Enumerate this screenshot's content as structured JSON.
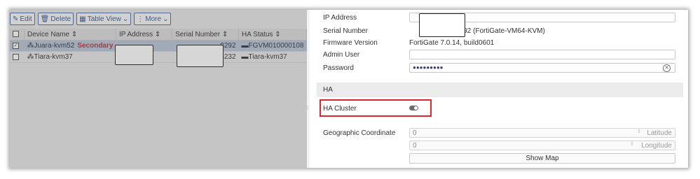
{
  "toolbar": {
    "edit_label": "Edit",
    "delete_label": "Delete",
    "tableview_label": "Table View",
    "more_label": "More"
  },
  "table": {
    "headers": [
      "Device Name",
      "IP Address",
      "Serial Number",
      "HA Status"
    ],
    "rows": [
      {
        "name": "Juara-kvm52",
        "badge": "Secondary",
        "serial_tail": "8292",
        "ha_status": "FGVM010000108"
      },
      {
        "name": "Tiara-kvm37",
        "badge": "",
        "serial_tail": "8232",
        "ha_status": "Tiara-kvm37"
      }
    ]
  },
  "panel": {
    "ip_label": "IP Address",
    "serial_label": "Serial Number",
    "serial_value": "8292 (FortiGate-VM64-KVM)",
    "firmware_label": "Firmware Version",
    "firmware_value": "FortiGate 7.0.14, build0601",
    "admin_label": "Admin User",
    "password_label": "Password",
    "password_value": "●●●●●●●●●",
    "ha_section": "HA",
    "ha_cluster_label": "HA Cluster",
    "ha_cluster_enabled": false,
    "geo_label": "Geographic Coordinate",
    "latitude_value": "0",
    "latitude_unit": "Latitude",
    "longitude_value": "0",
    "longitude_unit": "Longitude",
    "show_map_label": "Show Map"
  },
  "colors": {
    "accent": "#3a5a8c",
    "secondary_badge": "#d0282e",
    "highlight_box": "#d8282f",
    "selected_row": "#b7c6d6"
  }
}
